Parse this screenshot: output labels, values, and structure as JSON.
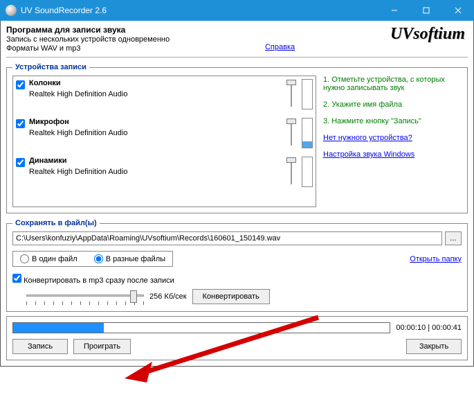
{
  "window": {
    "title": "UV SoundRecorder 2.6"
  },
  "header": {
    "title": "Программа для записи звука",
    "subtitle1": "Запись с нескольких устройств одновременно",
    "subtitle2": "Форматы WAV и mp3",
    "help_link": "Справка",
    "logo_text": "UVsoftium"
  },
  "devices_section": {
    "legend": "Устройства записи",
    "devices": [
      {
        "checked": true,
        "name": "Колонки",
        "driver": "Realtek High Definition Audio",
        "slider_pos": 0,
        "level_pct": 0
      },
      {
        "checked": true,
        "name": "Микрофон",
        "driver": "Realtek High Definition Audio",
        "slider_pos": 0,
        "level_pct": 22
      },
      {
        "checked": true,
        "name": "Динамики",
        "driver": "Realtek High Definition Audio",
        "slider_pos": 0,
        "level_pct": 0
      }
    ],
    "instructions": [
      "1. Отметьте устройства, с которых нужно записывать звук",
      "2. Укажите имя файла",
      "3. Нажмите кнопку \"Запись\""
    ],
    "link_no_device": "Нет нужного устройства?",
    "link_win_sound": "Настройка звука Windows"
  },
  "save_section": {
    "legend": "Сохранять в файл(ы)",
    "path": "C:\\Users\\konfuziy\\AppData\\Roaming\\UVsoftium\\Records\\160601_150149.wav",
    "browse": "...",
    "radio_single": "В один файл",
    "radio_multi": "В разные файлы",
    "radio_selected": "multi",
    "open_folder": "Открыть папку",
    "convert_checkbox": "Конвертировать в mp3 сразу после записи",
    "convert_checked": true,
    "bitrate_label": "256 Кб/сек",
    "convert_button": "Конвертировать"
  },
  "bottom": {
    "progress_pct": 24,
    "time_label": "00:00:10 | 00:00:41",
    "record_button": "Запись",
    "play_button": "Проиграть",
    "close_button": "Закрыть"
  }
}
